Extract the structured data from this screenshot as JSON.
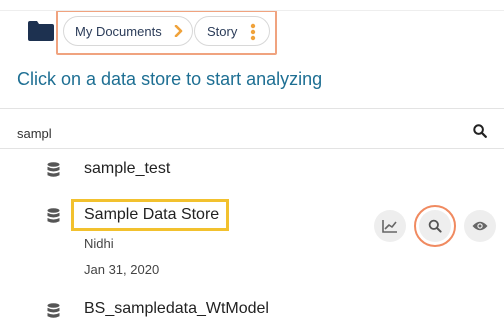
{
  "breadcrumb": {
    "items": [
      "My Documents",
      "Story"
    ]
  },
  "main": {
    "headline": "Click on a data store to start analyzing"
  },
  "search": {
    "value": "sampl"
  },
  "data_stores": [
    {
      "name": "sample_test"
    },
    {
      "name": "Sample Data Store",
      "owner": "Nidhi",
      "date": "Jan 31, 2020"
    },
    {
      "name": "BS_sampledata_WtModel"
    }
  ],
  "colors": {
    "brand_blue": "#1e6f93",
    "navy": "#2b3c59",
    "accent_orange": "#f08a60",
    "highlight_yellow": "#f2c12e"
  },
  "icons": [
    "folder-icon",
    "chevron-right-icon",
    "kebab-menu-icon",
    "search-icon",
    "database-icon",
    "line-chart-icon",
    "search-icon",
    "eye-icon"
  ]
}
